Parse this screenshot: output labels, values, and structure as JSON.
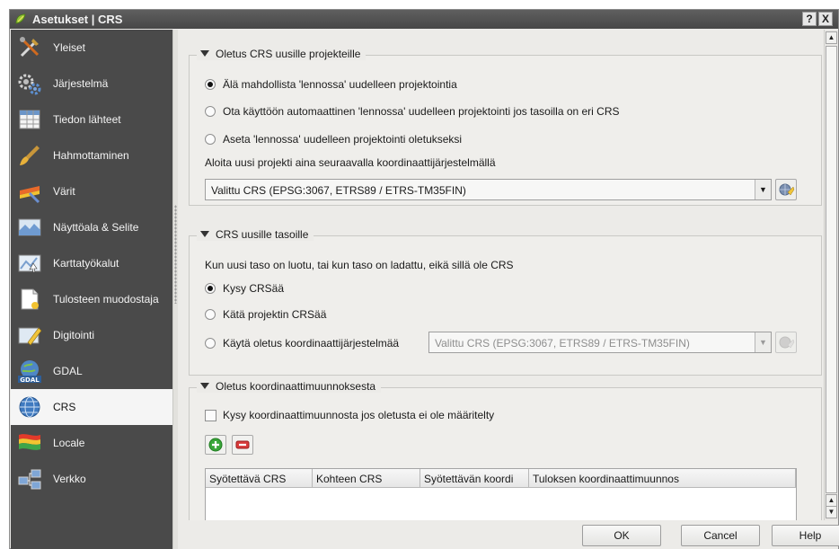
{
  "window": {
    "title": "Asetukset | CRS",
    "help_button": "?",
    "close_button": "X"
  },
  "sidebar": {
    "items": [
      {
        "label": "Yleiset",
        "icon": "tools-icon"
      },
      {
        "label": "Järjestelmä",
        "icon": "gears-icon"
      },
      {
        "label": "Tiedon lähteet",
        "icon": "table-icon"
      },
      {
        "label": "Hahmottaminen",
        "icon": "paintbrush-icon"
      },
      {
        "label": "Värit",
        "icon": "color-palette-icon"
      },
      {
        "label": "Näyttöala & Selite",
        "icon": "map-canvas-icon"
      },
      {
        "label": "Karttatyökalut",
        "icon": "map-tools-icon"
      },
      {
        "label": "Tulosteen muodostaja",
        "icon": "print-composer-icon"
      },
      {
        "label": "Digitointi",
        "icon": "digitizing-icon"
      },
      {
        "label": "GDAL",
        "icon": "gdal-icon"
      },
      {
        "label": "CRS",
        "icon": "globe-icon",
        "selected": true
      },
      {
        "label": "Locale",
        "icon": "locale-flag-icon"
      },
      {
        "label": "Verkko",
        "icon": "network-icon"
      }
    ]
  },
  "sections": {
    "default_crs": {
      "title": "Oletus CRS uusille projekteille",
      "options": [
        {
          "label": "Älä mahdollista 'lennossa' uudelleen projektointia",
          "checked": true
        },
        {
          "label": "Ota käyttöön automaattinen 'lennossa' uudelleen projektointi jos tasoilla on eri CRS",
          "checked": false
        },
        {
          "label": "Aseta 'lennossa' uudelleen projektointi oletukseksi",
          "checked": false
        }
      ],
      "combo_label": "Aloita uusi projekti aina seuraavalla koordinaattijärjestelmällä",
      "combo_value": "Valittu CRS (EPSG:3067, ETRS89 / ETRS-TM35FIN)"
    },
    "layer_crs": {
      "title": "CRS uusille tasoille",
      "description": "Kun uusi taso on luotu, tai kun taso on ladattu, eikä sillä ole CRS",
      "options": [
        {
          "label": "Kysy CRSää",
          "checked": true
        },
        {
          "label": "Kätä projektin CRSää",
          "checked": false
        },
        {
          "label": "Käytä oletus koordinaattijärjestelmää",
          "checked": false
        }
      ],
      "combo_value": "Valittu CRS (EPSG:3067, ETRS89 / ETRS-TM35FIN)",
      "combo_enabled": false
    },
    "transform": {
      "title": "Oletus koordinaattimuunnoksesta",
      "checkbox_label": "Kysy koordinaattimuunnosta jos oletusta ei ole määritelty",
      "checkbox_checked": false,
      "columns": [
        "Syötettävä CRS",
        "Kohteen CRS",
        "Syötettävän koordi",
        "Tuloksen koordinaattimuunnos"
      ]
    }
  },
  "footer": {
    "ok": "OK",
    "cancel": "Cancel",
    "help": "Help"
  }
}
